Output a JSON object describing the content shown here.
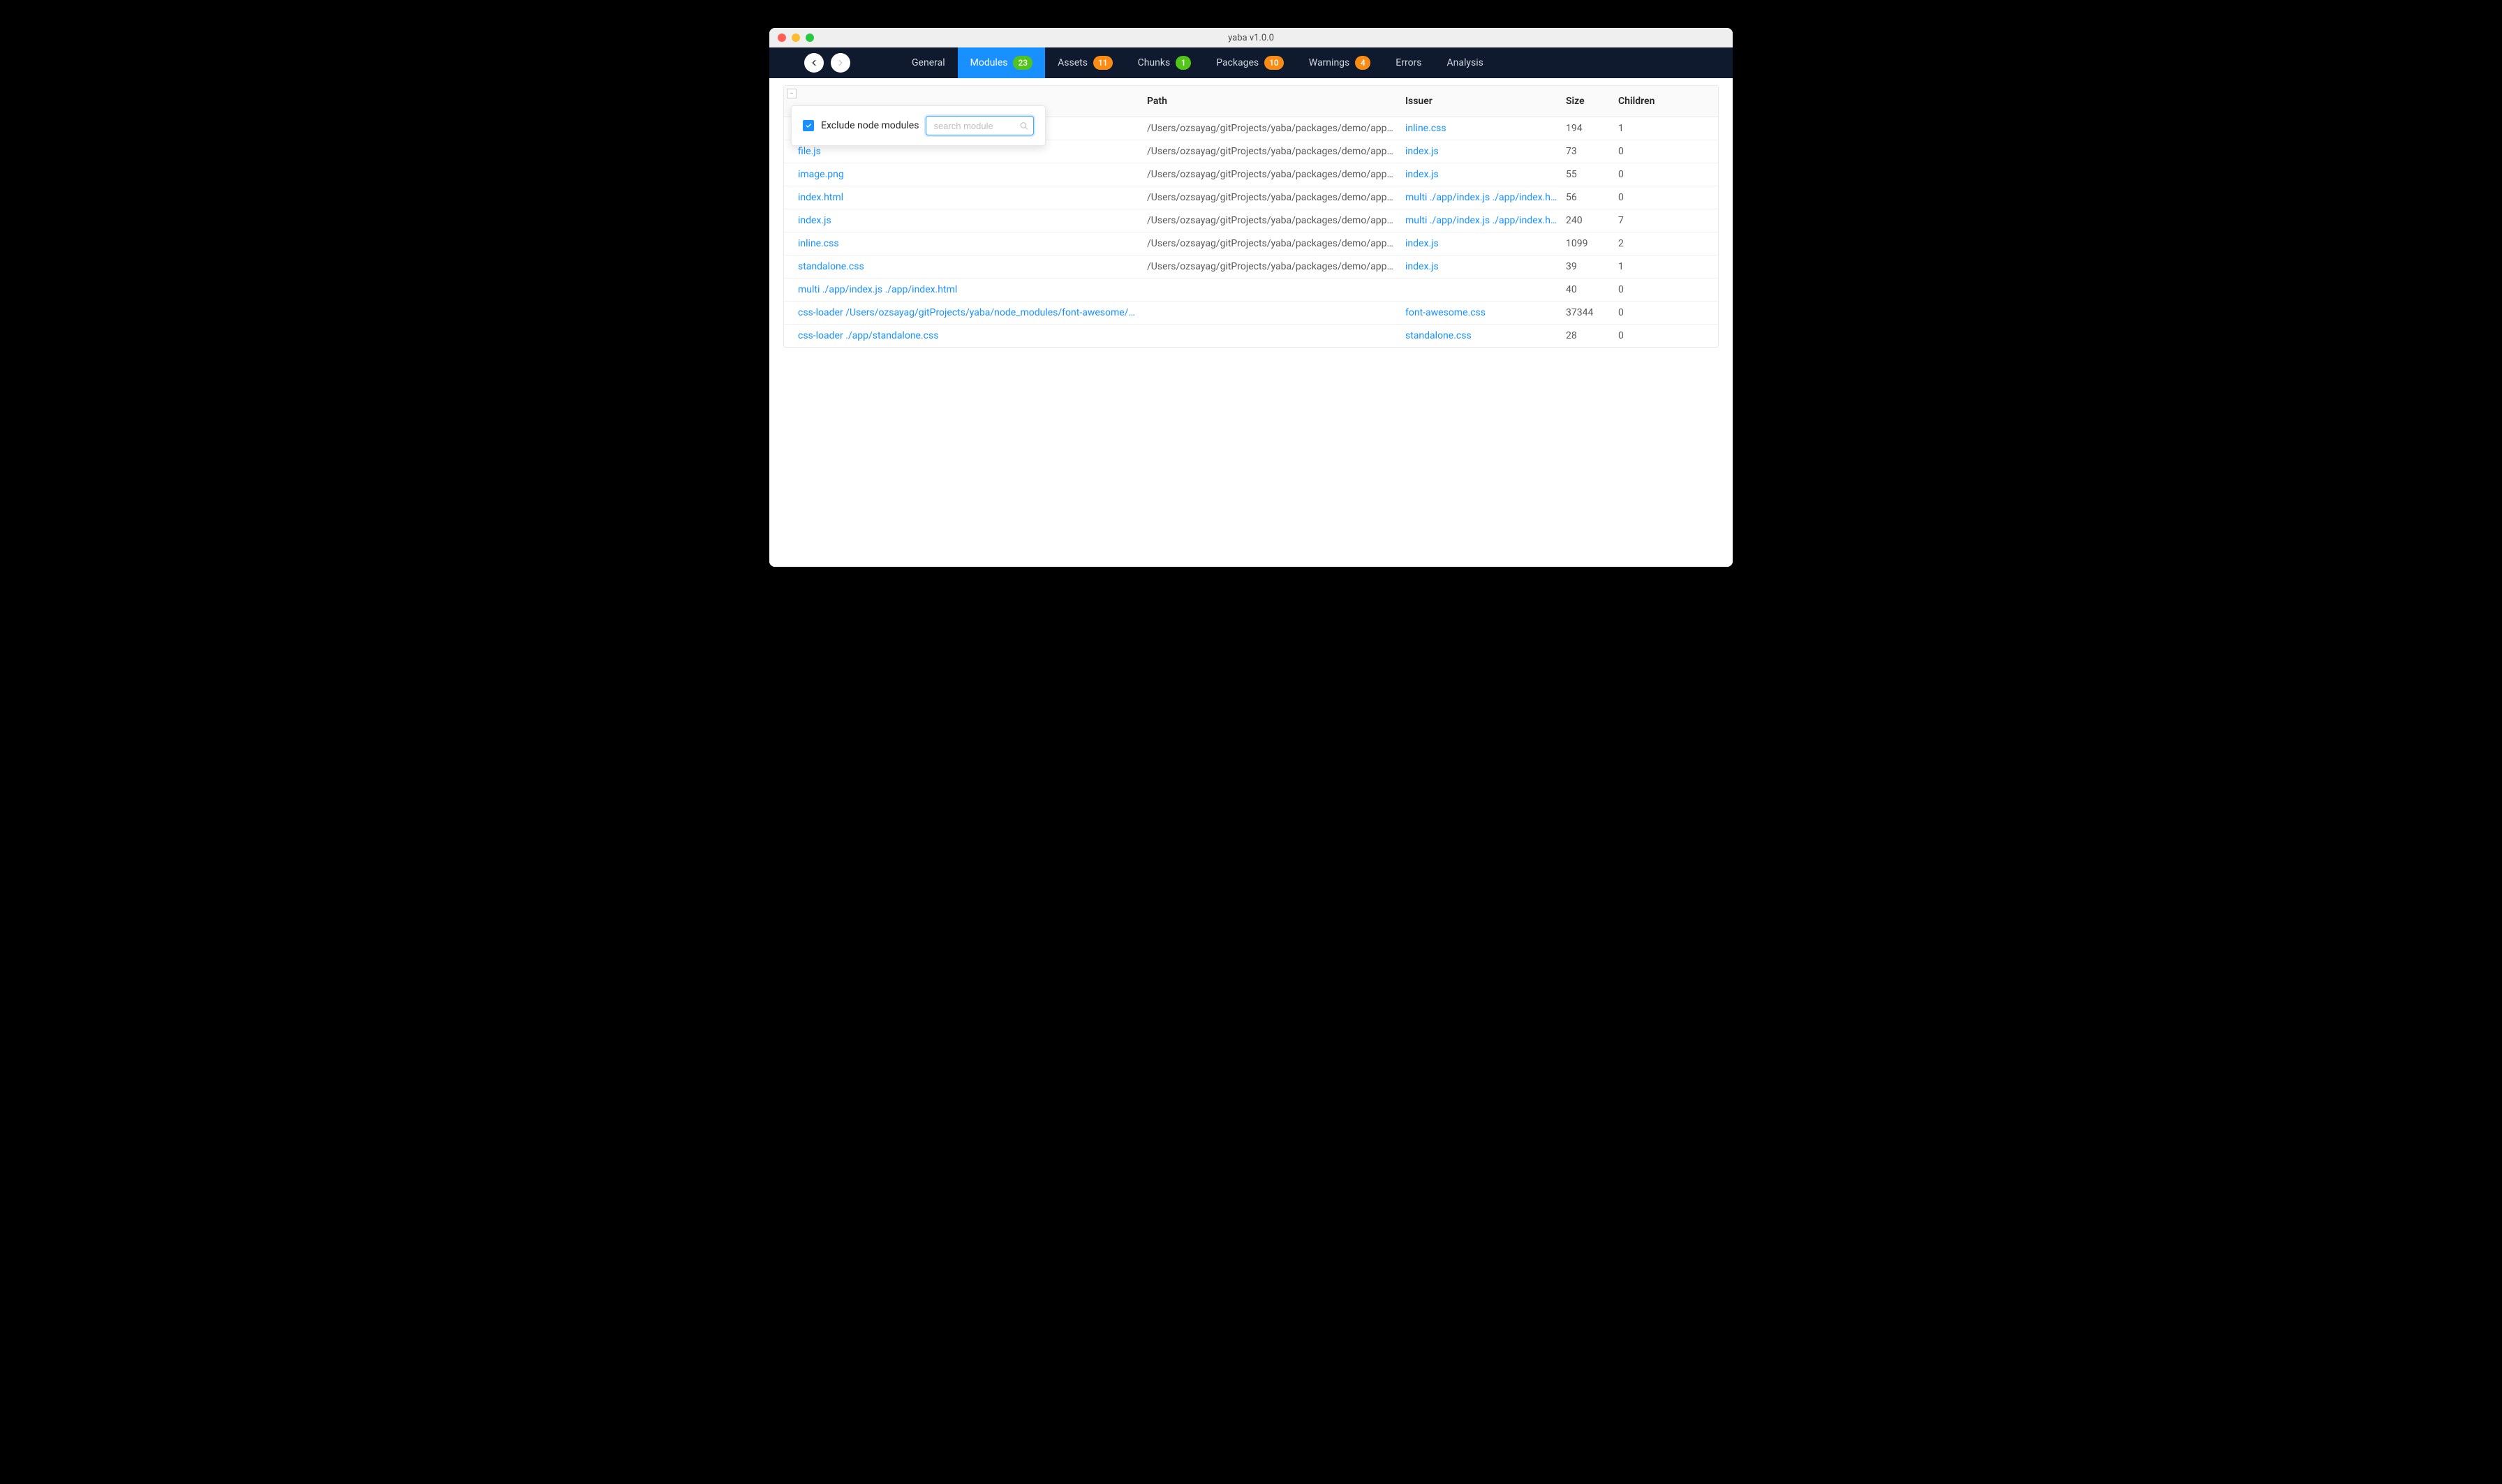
{
  "window": {
    "title": "yaba v1.0.0"
  },
  "nav": {
    "tabs": [
      {
        "label": "General",
        "badge": null,
        "active": false
      },
      {
        "label": "Modules",
        "badge": "23",
        "badgeColor": "green",
        "active": true
      },
      {
        "label": "Assets",
        "badge": "11",
        "badgeColor": "orange",
        "active": false
      },
      {
        "label": "Chunks",
        "badge": "1",
        "badgeColor": "green",
        "active": false
      },
      {
        "label": "Packages",
        "badge": "10",
        "badgeColor": "orange",
        "active": false
      },
      {
        "label": "Warnings",
        "badge": "4",
        "badgeColor": "orange",
        "active": false
      },
      {
        "label": "Errors",
        "badge": null,
        "active": false
      },
      {
        "label": "Analysis",
        "badge": null,
        "active": false
      }
    ]
  },
  "filter": {
    "exclude_label": "Exclude node modules",
    "exclude_checked": true,
    "search_placeholder": "search module"
  },
  "table": {
    "headers": {
      "name": "",
      "path": "Path",
      "issuer": "Issuer",
      "size": "Size",
      "children": "Children"
    },
    "rows": [
      {
        "name": "",
        "path": "/Users/ozsayag/gitProjects/yaba/packages/demo/app/inline.css",
        "issuer": "inline.css",
        "size": "194",
        "children": "1"
      },
      {
        "name": "file.js",
        "path": "/Users/ozsayag/gitProjects/yaba/packages/demo/app/file.js",
        "issuer": "index.js",
        "size": "73",
        "children": "0"
      },
      {
        "name": "image.png",
        "path": "/Users/ozsayag/gitProjects/yaba/packages/demo/app/image.png",
        "issuer": "index.js",
        "size": "55",
        "children": "0"
      },
      {
        "name": "index.html",
        "path": "/Users/ozsayag/gitProjects/yaba/packages/demo/app/index.html",
        "issuer": "multi ./app/index.js ./app/index.html",
        "size": "56",
        "children": "0"
      },
      {
        "name": "index.js",
        "path": "/Users/ozsayag/gitProjects/yaba/packages/demo/app/index.js",
        "issuer": "multi ./app/index.js ./app/index.html",
        "size": "240",
        "children": "7"
      },
      {
        "name": "inline.css",
        "path": "/Users/ozsayag/gitProjects/yaba/packages/demo/app/inline.css",
        "issuer": "index.js",
        "size": "1099",
        "children": "2"
      },
      {
        "name": "standalone.css",
        "path": "/Users/ozsayag/gitProjects/yaba/packages/demo/app/standalone.css",
        "issuer": "index.js",
        "size": "39",
        "children": "1"
      },
      {
        "name": "multi ./app/index.js ./app/index.html",
        "path": "",
        "issuer": "",
        "size": "40",
        "children": "0"
      },
      {
        "name": "css-loader /Users/ozsayag/gitProjects/yaba/node_modules/font-awesome/css/font-awesom...",
        "path": "",
        "issuer": "font-awesome.css",
        "size": "37344",
        "children": "0"
      },
      {
        "name": "css-loader ./app/standalone.css",
        "path": "",
        "issuer": "standalone.css",
        "size": "28",
        "children": "0"
      }
    ]
  }
}
